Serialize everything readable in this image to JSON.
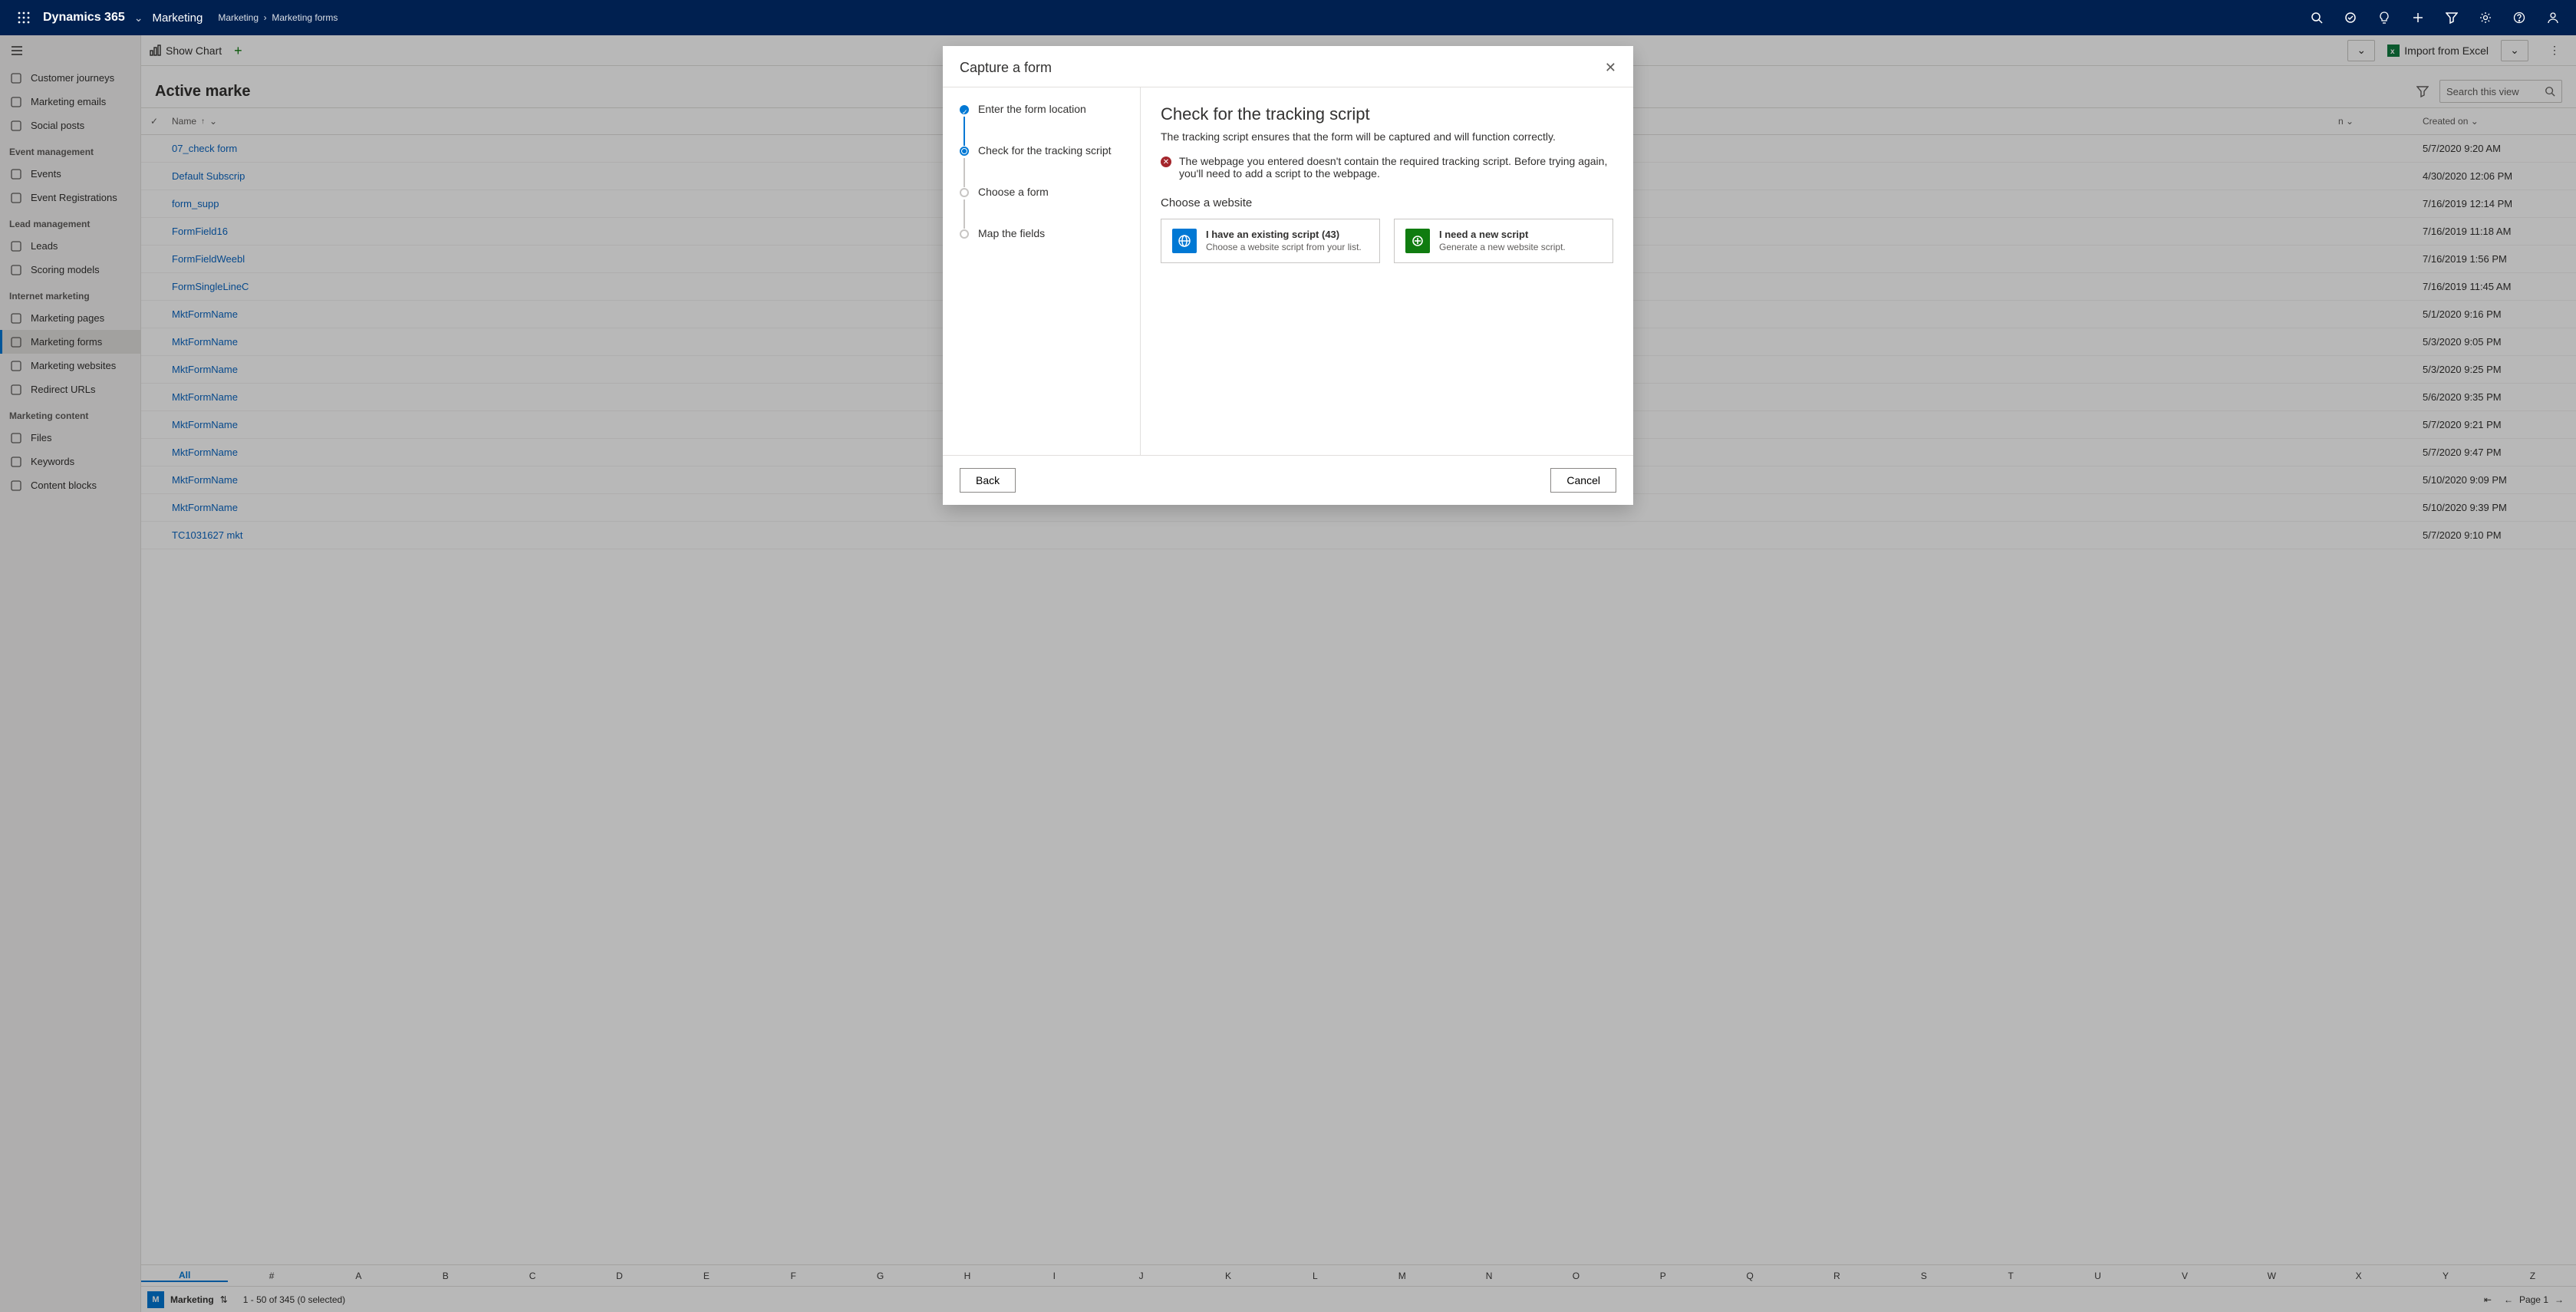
{
  "header": {
    "brand": "Dynamics 365",
    "area": "Marketing",
    "crumb1": "Marketing",
    "crumb2": "Marketing forms"
  },
  "commandbar": {
    "show_chart": "Show Chart",
    "import": "Import from Excel"
  },
  "sidebar": {
    "groups": [
      {
        "label": "",
        "items": [
          {
            "icon": "journey",
            "label": "Customer journeys"
          },
          {
            "icon": "mail",
            "label": "Marketing emails"
          },
          {
            "icon": "smile",
            "label": "Social posts"
          }
        ]
      },
      {
        "label": "Event management",
        "items": [
          {
            "icon": "cal",
            "label": "Events"
          },
          {
            "icon": "reg",
            "label": "Event Registrations"
          }
        ]
      },
      {
        "label": "Lead management",
        "items": [
          {
            "icon": "leads",
            "label": "Leads"
          },
          {
            "icon": "score",
            "label": "Scoring models"
          }
        ]
      },
      {
        "label": "Internet marketing",
        "items": [
          {
            "icon": "page",
            "label": "Marketing pages"
          },
          {
            "icon": "form",
            "label": "Marketing forms",
            "active": true
          },
          {
            "icon": "web",
            "label": "Marketing websites"
          },
          {
            "icon": "redir",
            "label": "Redirect URLs"
          }
        ]
      },
      {
        "label": "Marketing content",
        "items": [
          {
            "icon": "file",
            "label": "Files"
          },
          {
            "icon": "kw",
            "label": "Keywords"
          },
          {
            "icon": "block",
            "label": "Content blocks"
          }
        ]
      }
    ]
  },
  "page": {
    "title": "Active marke",
    "search_placeholder": "Search this view",
    "columns": {
      "name": "Name",
      "mid": "n",
      "created": "Created on"
    },
    "rows": [
      {
        "name": "07_check form",
        "date": "5/7/2020 9:20 AM"
      },
      {
        "name": "Default Subscrip",
        "date": "4/30/2020 12:06 PM"
      },
      {
        "name": "form_supp",
        "date": "7/16/2019 12:14 PM"
      },
      {
        "name": "FormField16",
        "date": "7/16/2019 11:18 AM"
      },
      {
        "name": "FormFieldWeebl",
        "date": "7/16/2019 1:56 PM"
      },
      {
        "name": "FormSingleLineC",
        "date": "7/16/2019 11:45 AM"
      },
      {
        "name": "MktFormName",
        "date": "5/1/2020 9:16 PM"
      },
      {
        "name": "MktFormName",
        "date": "5/3/2020 9:05 PM"
      },
      {
        "name": "MktFormName",
        "date": "5/3/2020 9:25 PM"
      },
      {
        "name": "MktFormName",
        "date": "5/6/2020 9:35 PM"
      },
      {
        "name": "MktFormName",
        "date": "5/7/2020 9:21 PM"
      },
      {
        "name": "MktFormName",
        "date": "5/7/2020 9:47 PM"
      },
      {
        "name": "MktFormName",
        "date": "5/10/2020 9:09 PM"
      },
      {
        "name": "MktFormName",
        "date": "5/10/2020 9:39 PM"
      },
      {
        "name": "TC1031627  mkt",
        "date": "5/7/2020 9:10 PM"
      }
    ],
    "alpha": [
      "All",
      "#",
      "A",
      "B",
      "C",
      "D",
      "E",
      "F",
      "G",
      "H",
      "I",
      "J",
      "K",
      "L",
      "M",
      "N",
      "O",
      "P",
      "Q",
      "R",
      "S",
      "T",
      "U",
      "V",
      "W",
      "X",
      "Y",
      "Z"
    ]
  },
  "status": {
    "area_letter": "M",
    "area_name": "Marketing",
    "count": "1 - 50 of 345 (0 selected)",
    "page": "Page 1"
  },
  "modal": {
    "title": "Capture a form",
    "steps": [
      {
        "label": "Enter the form location",
        "state": "done"
      },
      {
        "label": "Check for the tracking script",
        "state": "cur"
      },
      {
        "label": "Choose a form",
        "state": "todo"
      },
      {
        "label": "Map the fields",
        "state": "todo"
      }
    ],
    "heading": "Check for the tracking script",
    "sub": "The tracking script ensures that the form will be captured and will function correctly.",
    "error": "The webpage you entered doesn't contain the required tracking script. Before trying again, you'll need to add a script to the webpage.",
    "choose": "Choose a website",
    "card_existing_t": "I have an existing script (43)",
    "card_existing_d": "Choose a website script from your list.",
    "card_new_t": "I need a new script",
    "card_new_d": "Generate a new website script.",
    "back": "Back",
    "cancel": "Cancel"
  }
}
